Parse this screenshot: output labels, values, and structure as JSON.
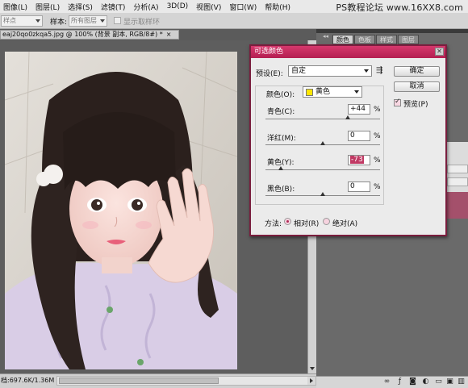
{
  "menu": [
    "图像(L)",
    "图层(L)",
    "选择(S)",
    "滤镜(T)",
    "分析(A)",
    "3D(D)",
    "视图(V)",
    "窗口(W)",
    "帮助(H)"
  ],
  "watermark": "PS教程论坛 www.16XX8.com",
  "options": {
    "size_value": "样点",
    "sample_label": "样本:",
    "sample_value": "所有图层",
    "show_ring": "显示取样环"
  },
  "document": {
    "tab_title": "eaj20qo0zkqa5.jpg @ 100% (背景 副本, RGB/8#) *",
    "close": "×",
    "status": "档:697.6K/1.36M"
  },
  "panels": {
    "tabs": [
      "颜色",
      "色板",
      "样式",
      "图层"
    ],
    "collapse": "◂◂"
  },
  "dialog": {
    "title": "可选颜色",
    "preset_label": "预设(E):",
    "preset_value": "自定",
    "ok": "确定",
    "cancel": "取消",
    "preview": "预览(P)",
    "colors_label": "颜色(O):",
    "colors_value": "黄色",
    "swatch_color": "#ffe600",
    "sliders": [
      {
        "label": "青色(C):",
        "value": "+44",
        "pct": "%",
        "level": 44
      },
      {
        "label": "洋红(M):",
        "value": "0",
        "pct": "%",
        "level": 0
      },
      {
        "label": "黄色(Y):",
        "value": "-73",
        "pct": "%",
        "level": -73
      },
      {
        "label": "黑色(B):",
        "value": "0",
        "pct": "%",
        "level": 0
      }
    ],
    "method_label": "方法:",
    "method_relative": "相对(R)",
    "method_absolute": "绝对(A)",
    "method_selected": "相对(R)"
  },
  "colors": {
    "title_bar": "#c42a5c",
    "accent": "#b02a57"
  }
}
